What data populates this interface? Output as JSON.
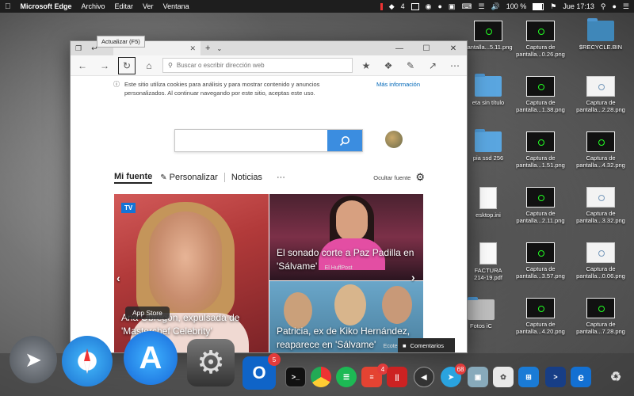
{
  "menubar": {
    "app_name": "Microsoft Edge",
    "menus": [
      "Archivo",
      "Editar",
      "Ver",
      "Ventana"
    ],
    "status_number": "4",
    "battery": "100 %",
    "clock": "Jue 17:13"
  },
  "desktop_icons": [
    {
      "label": "pantalla...5.11.png",
      "kind": "thumb"
    },
    {
      "label": "Captura de\npantalla...0.26.png",
      "kind": "thumb"
    },
    {
      "label": "$RECYCLE.BIN",
      "kind": "folder"
    },
    {
      "label": "eta sin título",
      "kind": "folder"
    },
    {
      "label": "Captura de\npantalla...1.38.png",
      "kind": "thumb"
    },
    {
      "label": "Captura de\npantalla...2.28.png",
      "kind": "thumb-light"
    },
    {
      "label": "pia ssd 256",
      "kind": "folder"
    },
    {
      "label": "Captura de\npantalla...1.51.png",
      "kind": "thumb"
    },
    {
      "label": "Captura de\npantalla...4.32.png",
      "kind": "thumb"
    },
    {
      "label": "esktop.ini",
      "kind": "doc"
    },
    {
      "label": "Captura de\npantalla...2.11.png",
      "kind": "thumb"
    },
    {
      "label": "Captura de\npantalla...3.32.png",
      "kind": "thumb-light"
    },
    {
      "label": "FACTURA\n214-19.pdf",
      "kind": "doc"
    },
    {
      "label": "Captura de\npantalla...3.57.png",
      "kind": "thumb"
    },
    {
      "label": "Captura de\npantalla...0.06.png",
      "kind": "thumb-light"
    },
    {
      "label": "Fotos iC",
      "kind": "folder"
    },
    {
      "label": "Captura de\npantalla...4.20.png",
      "kind": "thumb"
    },
    {
      "label": "Captura de\npantalla...7.28.png",
      "kind": "thumb"
    }
  ],
  "browser": {
    "tooltip": "Actualizar (F5)",
    "address_placeholder": "Buscar o escribir dirección web",
    "cookie_notice": "Este sitio utiliza cookies para análisis y para mostrar contenido y anuncios personalizados. Al continuar navegando por este sitio, aceptas este uso.",
    "cookie_more": "Más información",
    "feed_tabs": {
      "active": "Mi fuente",
      "personalize": "Personalizar",
      "news": "Noticias",
      "more": "···"
    },
    "hide_feed": "Ocultar fuente",
    "cards": {
      "big": {
        "badge": "TV",
        "headline": "Ana Obregón, expulsada de 'Masterchef Celebrity'"
      },
      "top_right": {
        "headline": "El sonado corte a Paz Padilla en 'Sálvame'",
        "source": "El HuffPost"
      },
      "bottom_right": {
        "headline": "Patricia, ex de Kiko Hernández, reaparece en 'Sálvame'",
        "source": "Ecoteuve"
      }
    },
    "feedback_label": "Comentarios"
  },
  "dock": {
    "tooltip": "App Store",
    "outlook_badge": "5",
    "todoist_badge": "4",
    "telegram_badge": "68"
  }
}
